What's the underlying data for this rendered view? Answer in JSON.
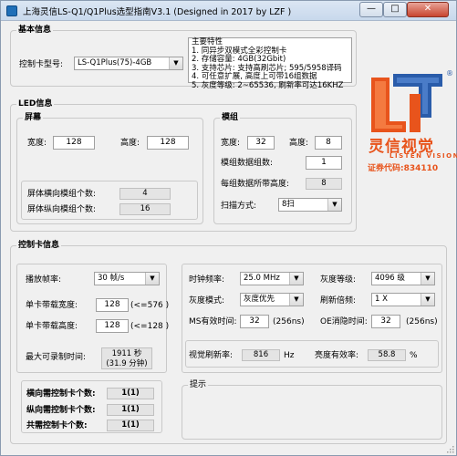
{
  "window": {
    "title": "上海灵信LS-Q1/Q1Plus选型指南V3.1  (Designed in 2017 by LZF )",
    "min_symbol": "—",
    "max_symbol": "□",
    "close_symbol": "✕"
  },
  "basic": {
    "group_title": "基本信息",
    "model_label": "控制卡型号:",
    "model_value": "LS-Q1Plus(75)-4GB",
    "features": [
      "主要特性",
      "1. 同异步双模式全彩控制卡",
      "2. 存储容量: 4GB(32Gbit)",
      "3. 支持芯片: 支持高刷芯片; 595/5958译码",
      "4. 可任意扩展, 高度上可带16组数据",
      "5. 灰度等级: 2~65536, 刷新率可达16KHZ"
    ]
  },
  "logo": {
    "brand_cn": "灵信视觉",
    "brand_en": "LISTEN VISION",
    "stock_code": "证券代码:834110",
    "registered": "®",
    "colors": {
      "orange": "#e8541c",
      "blue": "#2a5caa"
    }
  },
  "led": {
    "group_title": "LED信息",
    "screen": {
      "title": "屏幕",
      "width_label": "宽度:",
      "width_value": "128",
      "height_label": "高度:",
      "height_value": "128",
      "h_modules_label": "屏体横向模组个数:",
      "h_modules_value": "4",
      "v_modules_label": "屏体纵向模组个数:",
      "v_modules_value": "16"
    },
    "module": {
      "title": "模组",
      "width_label": "宽度:",
      "width_value": "32",
      "height_label": "高度:",
      "height_value": "8",
      "groups_label": "模组数据组数:",
      "groups_value": "1",
      "height_per_group_label": "每组数据所带高度:",
      "height_per_group_value": "8",
      "scan_label": "扫描方式:",
      "scan_value": "8扫"
    }
  },
  "card": {
    "group_title": "控制卡信息",
    "frame_rate_label": "播放帧率:",
    "frame_rate_value": "30 帧/s",
    "load_width_label": "单卡带载宽度:",
    "load_width_value": "128",
    "load_width_note": "(<=576 )",
    "load_height_label": "单卡带载高度:",
    "load_height_value": "128",
    "load_height_note": "(<=128 )",
    "max_record_label": "最大可录制时间:",
    "max_record_line1": "1911 秒",
    "max_record_line2": "(31.9 分钟)",
    "h_cards_label": "横向需控制卡个数:",
    "h_cards_value": "1(1)",
    "v_cards_label": "纵向需控制卡个数:",
    "v_cards_value": "1(1)",
    "total_cards_label": "共需控制卡个数:",
    "total_cards_value": "1(1)",
    "clock_label": "时钟频率:",
    "clock_value": "25.0 MHz",
    "gray_level_label": "灰度等级:",
    "gray_level_value": "4096 级",
    "gray_mode_label": "灰度模式:",
    "gray_mode_value": "灰度优先",
    "refresh_mult_label": "刷新倍频:",
    "refresh_mult_value": "1 X",
    "ms_label": "MS有效时间:",
    "ms_value": "32",
    "ms_unit": "(256ns)",
    "oe_label": "OE消隐时间:",
    "oe_value": "32",
    "oe_unit": "(256ns)",
    "refresh_rate_label": "视觉刷新率:",
    "refresh_rate_value": "816",
    "refresh_rate_unit": "Hz",
    "brightness_label": "亮度有效率:",
    "brightness_value": "58.8",
    "brightness_unit": "%",
    "hint_title": "提示"
  }
}
